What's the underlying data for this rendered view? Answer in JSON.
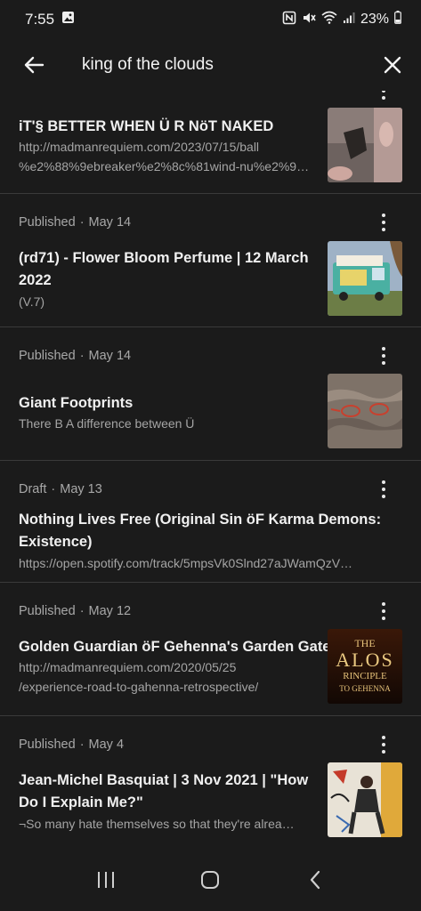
{
  "status_bar": {
    "time": "7:55",
    "battery": "23%"
  },
  "search": {
    "query": "king of the clouds"
  },
  "posts": [
    {
      "title": "iT'§ BETTER WHEN Ü R NöT NAKED",
      "sub1": "http://madmanrequiem.com/2023/07/15/ball",
      "sub2": "%e2%88%9ebreaker%e2%8c%81wind-nu%e2%9…"
    },
    {
      "status": "Published",
      "date": "May 14",
      "title1": "(rd71) - Flower Bloom Perfume | 12 March",
      "title2": "2022",
      "sub1": "(V.7)"
    },
    {
      "status": "Published",
      "date": "May 14",
      "title": "Giant Footprints",
      "sub1": "There B A difference between Ü"
    },
    {
      "status": "Draft",
      "date": "May 13",
      "title1": "Nothing Lives Free (Original Sin öF Karma Demons:",
      "title2": "Existence)",
      "sub1": "https://open.spotify.com/track/5mpsVk0Slnd27aJWamQzV…"
    },
    {
      "status": "Published",
      "date": "May 12",
      "title": "Golden Guardian öF Gehenna's Garden Gates",
      "sub1": "http://madmanrequiem.com/2020/05/25",
      "sub2": "/experience-road-to-gahenna-retrospective/",
      "thumb_text": {
        "line1": "THE",
        "line2": "ALOS",
        "line3": "RINCIPLE",
        "line4": "TO GEHENNA"
      }
    },
    {
      "status": "Published",
      "date": "May 4",
      "title1": "Jean-Michel Basquiat | 3 Nov 2021 | \"How",
      "title2": "Do I Explain Me?\"",
      "sub1": "¬So many hate themselves so that they're alrea…"
    }
  ],
  "colors": {
    "background": "#1b1b1b",
    "divider": "#3a3a3a",
    "text": "#f0f0f0",
    "muted": "#a8a8a8"
  }
}
